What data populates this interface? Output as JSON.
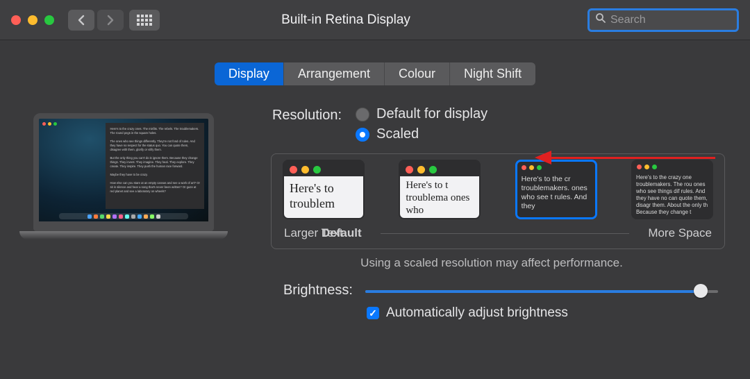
{
  "window": {
    "title": "Built-in Retina Display"
  },
  "search": {
    "placeholder": "Search",
    "value": ""
  },
  "tabs": [
    "Display",
    "Arrangement",
    "Colour",
    "Night Shift"
  ],
  "active_tab": 0,
  "resolution": {
    "label": "Resolution:",
    "options": [
      "Default for display",
      "Scaled"
    ],
    "selected": 1
  },
  "scaled": {
    "thumbnails": [
      {
        "text": "Here's to troublem"
      },
      {
        "text": "Here's to t troublema ones who"
      },
      {
        "text": "Here's to the cr troublemakers. ones who see t rules. And they"
      },
      {
        "text": "Here's to the crazy one troublemakers. The rou ones who see things dif rules. And they have no can quote them, disagr them. About the only th Because they change t"
      }
    ],
    "selected": 2,
    "larger_label": "Larger Text",
    "default_label": "Default",
    "more_label": "More Space",
    "warning": "Using a scaled resolution may affect performance."
  },
  "brightness": {
    "label": "Brightness:",
    "percent": 95,
    "auto_checked": true,
    "auto_label": "Automatically adjust brightness"
  },
  "colors": {
    "accent": "#0a78ff",
    "annotation": "#e02020"
  }
}
